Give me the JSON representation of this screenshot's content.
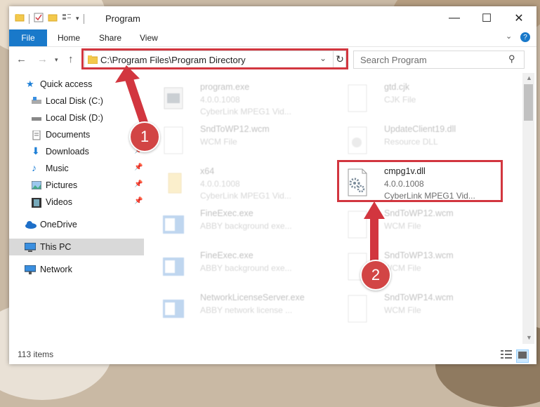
{
  "window": {
    "title": "Program"
  },
  "ribbon": {
    "tabs": [
      "File",
      "Home",
      "Share",
      "View"
    ]
  },
  "address": {
    "path": "C:\\Program Files\\Program Directory"
  },
  "search": {
    "placeholder": "Search Program"
  },
  "sidebar": {
    "items": [
      {
        "label": "Quick access",
        "icon": "star-icon"
      },
      {
        "label": "Local Disk (C:)",
        "icon": "drive-icon"
      },
      {
        "label": "Local Disk (D:)",
        "icon": "drive-icon"
      },
      {
        "label": "Documents",
        "icon": "documents-icon"
      },
      {
        "label": "Downloads",
        "icon": "download-arrow-icon"
      },
      {
        "label": "Music",
        "icon": "music-note-icon"
      },
      {
        "label": "Pictures",
        "icon": "pictures-icon"
      },
      {
        "label": "Videos",
        "icon": "videos-icon"
      },
      {
        "label": "OneDrive",
        "icon": "cloud-icon"
      },
      {
        "label": "This PC",
        "icon": "monitor-icon"
      },
      {
        "label": "Network",
        "icon": "network-icon"
      }
    ]
  },
  "files": [
    {
      "name": "program.exe",
      "type": "4.0.0.1008",
      "sub": "CyberLink MPEG1 Vid..."
    },
    {
      "name": "gtd.cjk",
      "type": "CJK File",
      "sub": ""
    },
    {
      "name": "SndToWP12.wcm",
      "type": "WCM File",
      "sub": ""
    },
    {
      "name": "UpdateClient19.dll",
      "type": "Resource DLL",
      "sub": ""
    },
    {
      "name": "x64",
      "type": "4.0.0.1008",
      "sub": "CyberLink MPEG1 Vid..."
    },
    {
      "name": "cmpg1v.dll",
      "type": "4.0.0.1008",
      "sub": "CyberLink MPEG1 Vid..."
    },
    {
      "name": "FineExec.exe",
      "type": "ABBY background exe...",
      "sub": ""
    },
    {
      "name": "SndToWP12.wcm",
      "type": "WCM File",
      "sub": ""
    },
    {
      "name": "FineExec.exe",
      "type": "ABBY background exe...",
      "sub": ""
    },
    {
      "name": "SndToWP13.wcm",
      "type": "WCM File",
      "sub": ""
    },
    {
      "name": "NetworkLicenseServer.exe",
      "type": "ABBY network license ...",
      "sub": ""
    },
    {
      "name": "SndToWP14.wcm",
      "type": "WCM File",
      "sub": ""
    }
  ],
  "status": {
    "count": "113 items"
  },
  "annotations": {
    "badge1": "1",
    "badge2": "2"
  },
  "colors": {
    "accent": "#1979ca",
    "highlight": "#d2363f"
  }
}
